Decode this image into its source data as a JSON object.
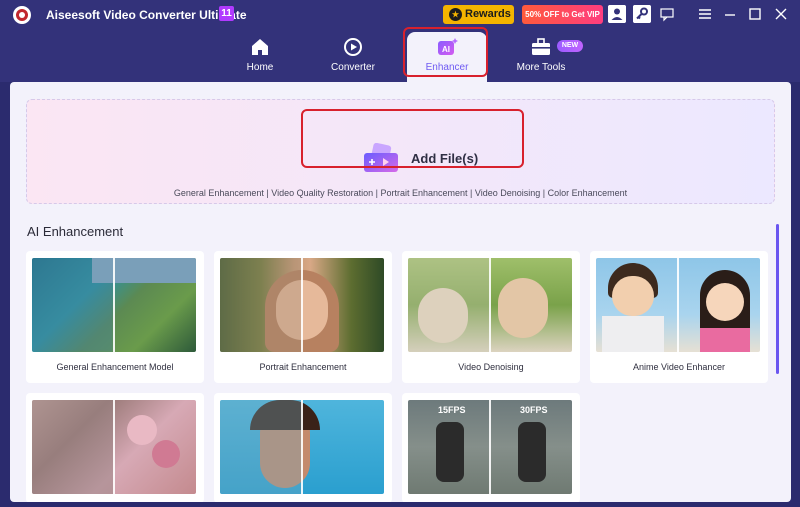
{
  "app": {
    "title": "Aiseesoft Video Converter Ultimate",
    "version_badge": "11"
  },
  "titlebar": {
    "rewards_label": "Rewards",
    "promo_label": "50% OFF to Get VIP",
    "icons": [
      "user-icon",
      "key-icon",
      "chat-icon",
      "menu-icon",
      "minimize-icon",
      "maximize-icon",
      "close-icon"
    ]
  },
  "nav": {
    "items": [
      {
        "label": "Home",
        "icon": "home-icon"
      },
      {
        "label": "Converter",
        "icon": "converter-icon"
      },
      {
        "label": "Enhancer",
        "icon": "ai-icon",
        "active": true
      },
      {
        "label": "More Tools",
        "icon": "toolbox-icon"
      }
    ],
    "new_badge": "NEW"
  },
  "dropzone": {
    "add_label": "Add File(s)",
    "types": "General Enhancement | Video Quality Restoration | Portrait Enhancement | Video Denoising | Color Enhancement"
  },
  "section": {
    "title": "AI Enhancement"
  },
  "cards": [
    {
      "label": "General Enhancement Model"
    },
    {
      "label": "Portrait Enhancement"
    },
    {
      "label": "Video Denoising"
    },
    {
      "label": "Anime Video Enhancer"
    },
    {
      "label": ""
    },
    {
      "label": ""
    },
    {
      "label": "",
      "overlay_left": "15FPS",
      "overlay_right": "30FPS"
    }
  ],
  "colors": {
    "titlebar": "#33327a",
    "accent": "#6f5bf2",
    "highlight": "#d8212d",
    "rewards": "#f4b400"
  }
}
